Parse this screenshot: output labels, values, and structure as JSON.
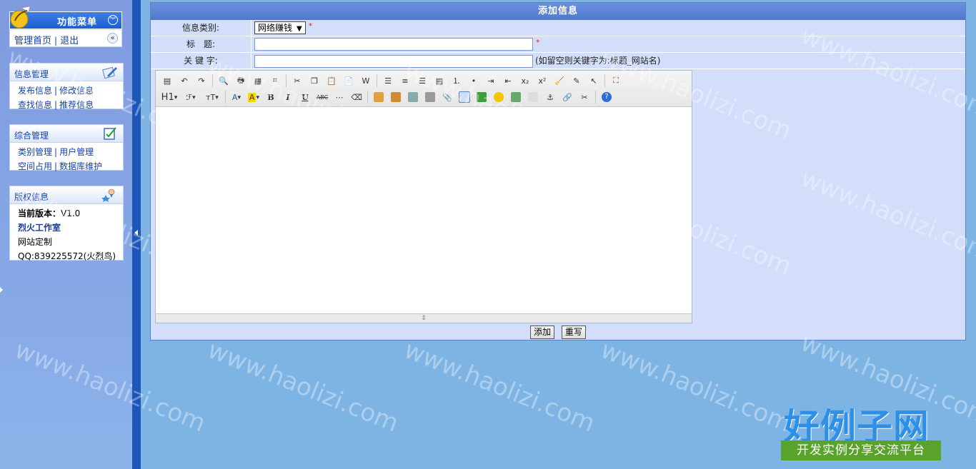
{
  "sidebar": {
    "menu_title": "功能菜单",
    "nav": {
      "home": "管理首页",
      "logout": "退出",
      "sep": "|"
    },
    "sections": [
      {
        "title": "信息管理",
        "icon": "pencil-paper-icon",
        "rows": [
          [
            "发布信息",
            "修改信息"
          ],
          [
            "查找信息",
            "推荐信息"
          ]
        ]
      },
      {
        "title": "综合管理",
        "icon": "checklist-icon",
        "rows": [
          [
            "类别管理",
            "用户管理"
          ],
          [
            "空间占用",
            "数据库维护"
          ]
        ]
      },
      {
        "title": "版权信息",
        "icon": "user-star-icon",
        "version_label": "当前版本：",
        "version": "V1.0",
        "studio": "烈火工作室",
        "service": "网站定制",
        "qq": "QQ:839225572(火烈鸟)"
      }
    ]
  },
  "panel": {
    "title": "添加信息",
    "fields": {
      "category": {
        "label": "信息类别:",
        "value": "网络赚钱",
        "required": "*"
      },
      "title": {
        "label": "标　题:",
        "value": "",
        "required": "*"
      },
      "keywords": {
        "label": "关 键 字:",
        "value": "",
        "hint": "(如留空则关键字为:标题_网站名)"
      }
    },
    "buttons": {
      "submit": "添加",
      "reset": "重写"
    }
  },
  "editor": {
    "toolbar_row1": [
      "source-icon",
      "undo-icon",
      "redo-icon",
      "preview-icon",
      "print-icon",
      "template-icon",
      "code-icon",
      "cut-icon",
      "copy-icon",
      "paste-icon",
      "paste-text-icon",
      "paste-word-icon",
      "align-left-icon",
      "align-center-icon",
      "align-right-icon",
      "justify-icon",
      "ordered-list-icon",
      "unordered-list-icon",
      "indent-icon",
      "outdent-icon",
      "subscript-icon",
      "superscript-icon",
      "clear-format-icon",
      "select-all-icon",
      "select-icon",
      "fullscreen-icon"
    ],
    "toolbar_row2_text": {
      "heading": "H1",
      "font": "ℱ",
      "size": "тT",
      "bold": "B",
      "italic": "I",
      "underline": "U",
      "strike": "ABC"
    }
  },
  "watermark": "www.haolizi.com",
  "brand": {
    "name": "好例子网",
    "slogan": "开发实例分享交流平台"
  },
  "colors": {
    "header_blue": "#4f79ce",
    "panel_bg": "#d3defa",
    "page_bg": "#7eb4e4",
    "divider": "#1d55b8",
    "brand_green": "#5aa32a"
  }
}
